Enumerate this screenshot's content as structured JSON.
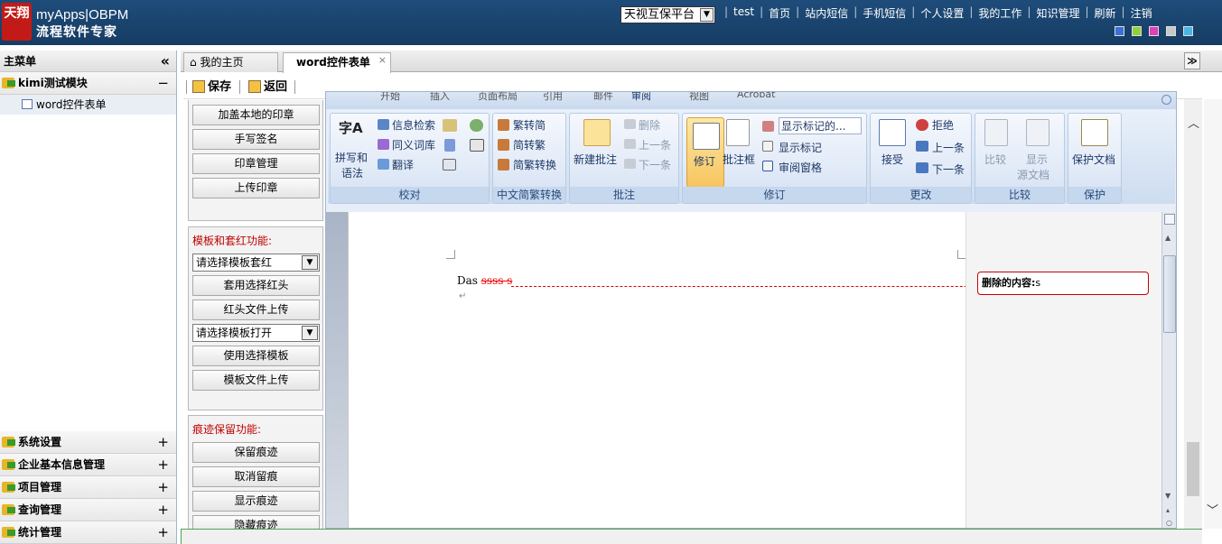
{
  "header": {
    "logo_mark": "天翔",
    "brand_line1": "myApps|OBPM",
    "brand_line2": "流程软件专家",
    "platform_select": "天视互保平台",
    "nav": [
      "test",
      "首页",
      "站内短信",
      "手机短信",
      "个人设置",
      "我的工作",
      "知识管理",
      "刷新",
      "注销"
    ],
    "theme_colors": [
      "#3b6fd8",
      "#8fd23a",
      "#e040b8",
      "#c8c8c8",
      "#49b6e8"
    ]
  },
  "sidebar": {
    "title": "主菜单",
    "collapse": "«",
    "top_group": {
      "label": "kimi测试模块",
      "toggle": "−"
    },
    "items": [
      {
        "label": "word控件表单"
      }
    ],
    "bottom_groups": [
      {
        "label": "系统设置",
        "toggle": "+"
      },
      {
        "label": "企业基本信息管理",
        "toggle": "+"
      },
      {
        "label": "项目管理",
        "toggle": "+"
      },
      {
        "label": "查询管理",
        "toggle": "+"
      },
      {
        "label": "统计管理",
        "toggle": "+"
      }
    ]
  },
  "tabs": [
    {
      "label": "我的主页"
    },
    {
      "label": "word控件表单",
      "close": "×"
    }
  ],
  "tab_dropdown": "≫",
  "toolbar": {
    "save": "保存",
    "back": "返回"
  },
  "functions": {
    "seal_buttons": [
      "加盖本地的印章",
      "手写签名",
      "印章管理",
      "上传印章"
    ],
    "template": {
      "label": "模板和套红功能:",
      "select1": "请选择模板套红",
      "btn1": "套用选择红头",
      "btn2": "红头文件上传",
      "select2": "请选择模板打开",
      "btn3": "使用选择模板",
      "btn4": "模板文件上传"
    },
    "trace": {
      "label": "痕迹保留功能:",
      "buttons": [
        "保留痕迹",
        "取消留痕",
        "显示痕迹",
        "隐藏痕迹"
      ]
    }
  },
  "ribbon": {
    "tabs": [
      "开始",
      "插入",
      "页面布局",
      "引用",
      "邮件",
      "审阅",
      "视图",
      "Acrobat"
    ],
    "groups": {
      "proofing": {
        "label": "校对",
        "spell": "拼写和",
        "spell2": "语法",
        "research": "信息检索",
        "thesaurus": "同义词库",
        "translate": "翻译"
      },
      "chinese": {
        "label": "中文简繁转换",
        "t2s": "繁转简",
        "s2t": "简转繁",
        "convert": "简繁转换"
      },
      "comments": {
        "label": "批注",
        "new": "新建批注",
        "delete": "删除",
        "prev": "上一条",
        "next": "下一条"
      },
      "tracking": {
        "label": "修订",
        "track": "修订",
        "balloons": "批注框",
        "display": "显示标记的...",
        "show_markup": "显示标记",
        "pane": "审阅窗格"
      },
      "changes": {
        "label": "更改",
        "accept": "接受",
        "reject": "拒绝",
        "prev": "上一条",
        "next": "下一条"
      },
      "compare": {
        "label": "比较",
        "compare": "比较",
        "show": "显示",
        "source": "源文档"
      },
      "protect": {
        "label": "保护",
        "protect": "保护文档"
      }
    }
  },
  "document": {
    "text_before": "Das ",
    "deleted": "ssss s",
    "balloon_label": "删除的内容:",
    "balloon_value": "s",
    "para_mark": "↵"
  }
}
